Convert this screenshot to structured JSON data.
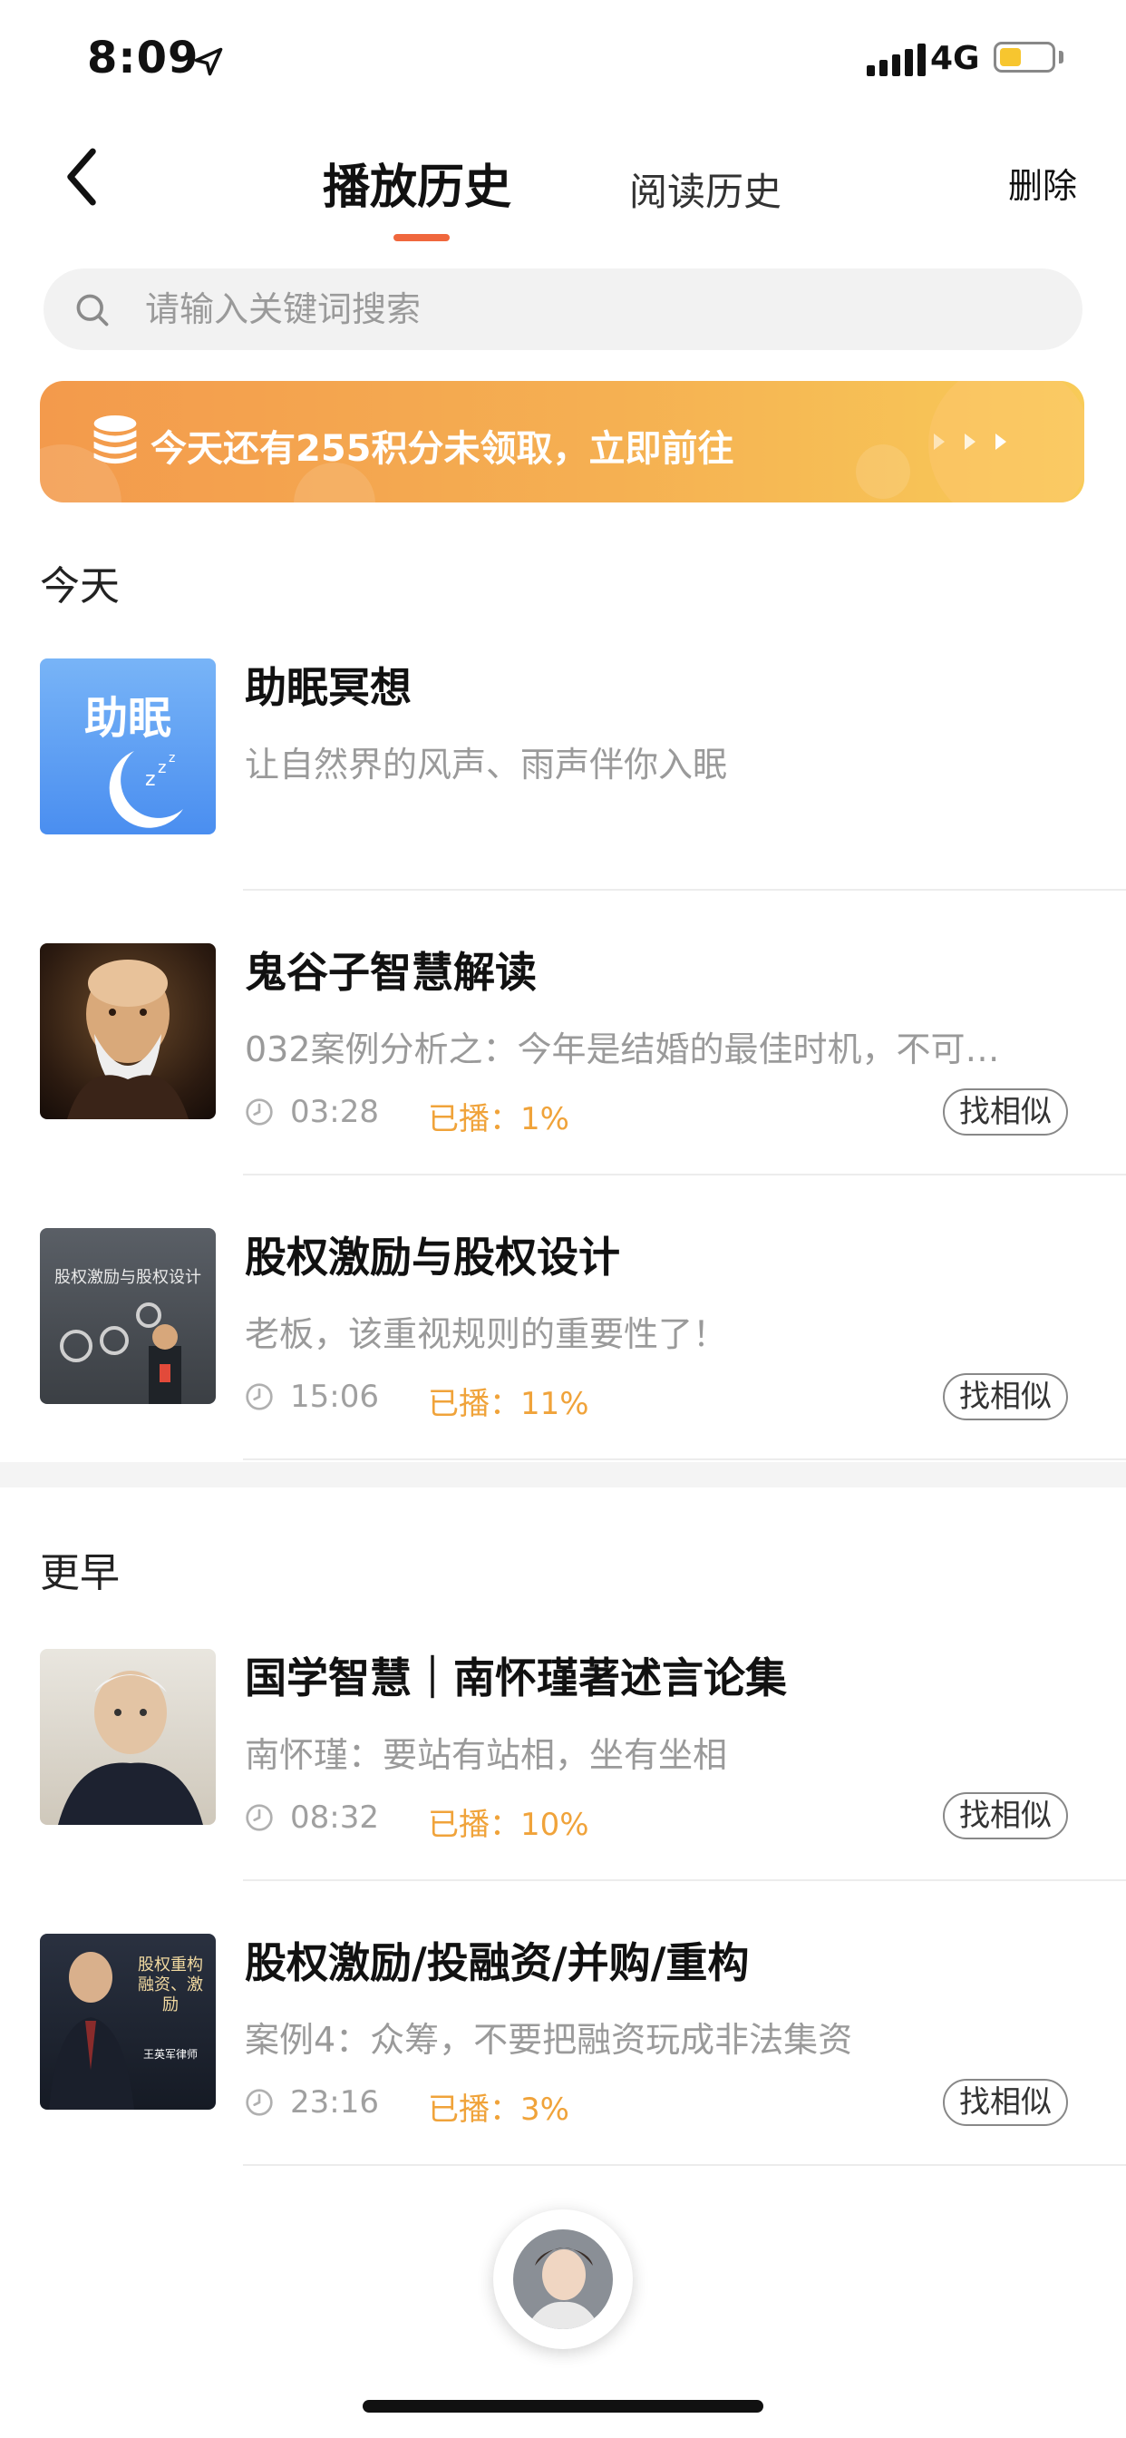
{
  "status_bar": {
    "time": "8:09",
    "network": "4G",
    "battery_level": 0.42
  },
  "header": {
    "tabs": [
      {
        "label": "播放历史",
        "active": true
      },
      {
        "label": "阅读历史",
        "active": false
      }
    ],
    "delete_label": "删除"
  },
  "search": {
    "placeholder": "请输入关键词搜索"
  },
  "banner": {
    "text": "今天还有255积分未领取，立即前往"
  },
  "sections": [
    {
      "title": "今天",
      "items": [
        {
          "cover_text": "助眠",
          "title": "助眠冥想",
          "subtitle": "让自然界的风声、雨声伴你入眠"
        },
        {
          "title": "鬼谷子智慧解读",
          "subtitle": "032案例分析之：今年是结婚的最佳时机，不可…",
          "duration": "03:28",
          "progress": "已播：1%",
          "similar_label": "找相似"
        },
        {
          "cover_text": "股权激励与股权设计",
          "title": "股权激励与股权设计",
          "subtitle": "老板，该重视规则的重要性了！",
          "duration": "15:06",
          "progress": "已播：11%",
          "similar_label": "找相似"
        }
      ]
    },
    {
      "title": "更早",
      "items": [
        {
          "title": "国学智慧｜南怀瑾著述言论集",
          "subtitle": "南怀瑾：要站有站相，坐有坐相",
          "duration": "08:32",
          "progress": "已播：10%",
          "similar_label": "找相似"
        },
        {
          "cover_text": "股权重构 融资、激励",
          "cover_text2": "王英军律师",
          "title": "股权激励/投融资/并购/重构",
          "subtitle": "案例4：众筹，不要把融资玩成非法集资",
          "duration": "23:16",
          "progress": "已播：3%",
          "similar_label": "找相似"
        }
      ]
    }
  ],
  "colors": {
    "accent": "#f0673d",
    "progress": "#f0a33a",
    "banner_start": "#f39a4c",
    "banner_end": "#f8cb58"
  }
}
